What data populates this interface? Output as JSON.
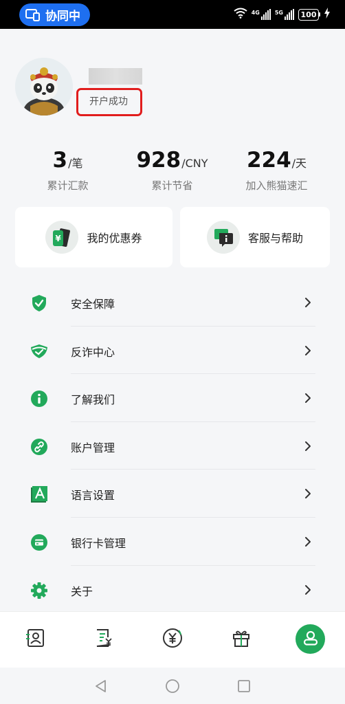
{
  "status_bar": {
    "collab_label": "协同中",
    "signal_1_tag": "4G",
    "signal_2_tag": "5G",
    "battery": "100"
  },
  "profile": {
    "status": "开户成功"
  },
  "stats": [
    {
      "value": "3",
      "unit": "/笔",
      "label": "累计汇款"
    },
    {
      "value": "928",
      "unit": "/CNY",
      "label": "累计节省"
    },
    {
      "value": "224",
      "unit": "/天",
      "label": "加入熊猫速汇"
    }
  ],
  "cards": [
    {
      "label": "我的优惠券",
      "icon": "coupon-icon"
    },
    {
      "label": "客服与帮助",
      "icon": "customer-service-icon"
    }
  ],
  "menu": [
    {
      "label": "安全保障",
      "icon": "shield-check-icon"
    },
    {
      "label": "反诈中心",
      "icon": "anti-fraud-shield-icon"
    },
    {
      "label": "了解我们",
      "icon": "info-icon"
    },
    {
      "label": "账户管理",
      "icon": "link-icon"
    },
    {
      "label": "语言设置",
      "icon": "language-icon"
    },
    {
      "label": "银行卡管理",
      "icon": "bank-card-icon"
    },
    {
      "label": "关于",
      "icon": "gear-icon"
    }
  ],
  "tabs": [
    {
      "name": "contacts",
      "icon": "contact-card-icon",
      "active": false
    },
    {
      "name": "records",
      "icon": "bill-list-icon",
      "active": false
    },
    {
      "name": "remit",
      "icon": "yuan-circle-icon",
      "active": false
    },
    {
      "name": "gifts",
      "icon": "gift-icon",
      "active": false
    },
    {
      "name": "me",
      "icon": "user-icon",
      "active": true
    }
  ],
  "colors": {
    "accent": "#22a95b",
    "highlight": "#e11d1d",
    "collab_pill": "#1e6ff0"
  }
}
